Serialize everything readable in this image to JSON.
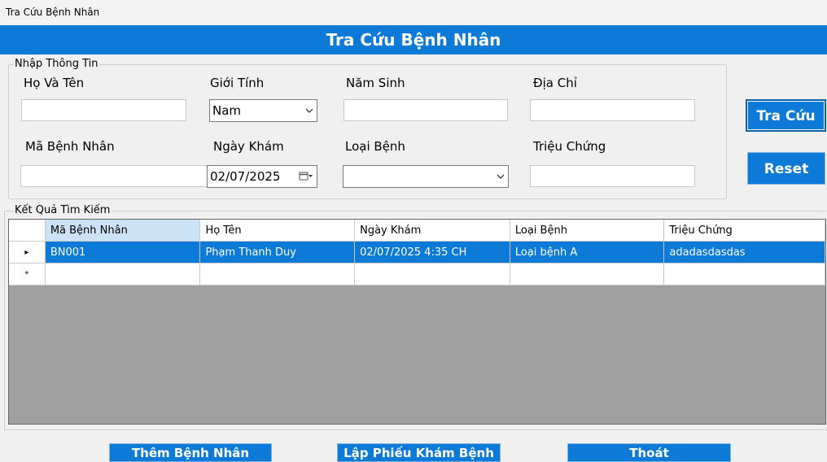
{
  "window": {
    "title": "Tra Cứu Bệnh Nhân"
  },
  "header": {
    "title": "Tra Cứu Bệnh Nhân"
  },
  "input_group": {
    "legend": "Nhập Thông Tin",
    "name_label": "Họ Và Tên",
    "name_value": "",
    "gender_label": "Giới Tính",
    "gender_value": "Nam",
    "birth_year_label": "Năm Sinh",
    "birth_year_value": "",
    "address_label": "Địa Chỉ",
    "address_value": "",
    "patient_id_label": "Mã Bệnh Nhân",
    "patient_id_value": "",
    "exam_date_label": "Ngày Khám",
    "exam_date_value": "02/07/2025",
    "disease_type_label": "Loại Bệnh",
    "disease_type_value": "",
    "symptoms_label": "Triệu Chứng",
    "symptoms_value": ""
  },
  "side_buttons": {
    "search": "Tra Cứu",
    "reset": "Reset"
  },
  "results_group": {
    "legend": "Kết Quả Tìm Kiếm",
    "columns": [
      "Mã Bệnh Nhân",
      "Họ Tên",
      "Ngày Khám",
      "Loại Bệnh",
      "Triệu Chứng"
    ],
    "rows": [
      [
        "BN001",
        "Phạm Thanh Duy",
        "02/07/2025 4:35 CH",
        "Loại bệnh A",
        "adadasdasdas"
      ]
    ],
    "current_row_marker": "▸",
    "new_row_marker": "*"
  },
  "bottom_buttons": {
    "add_patient": "Thêm Bệnh Nhân",
    "create_exam_form": "Lập Phiếu Khám Bệnh",
    "exit": "Thoát"
  },
  "icons": {
    "dropdown": "chevron-down-icon",
    "calendar": "calendar-icon"
  },
  "colors": {
    "accent": "#0c7ad6",
    "grid_empty": "#a0a0a0",
    "selected_header": "#cce3f7"
  }
}
